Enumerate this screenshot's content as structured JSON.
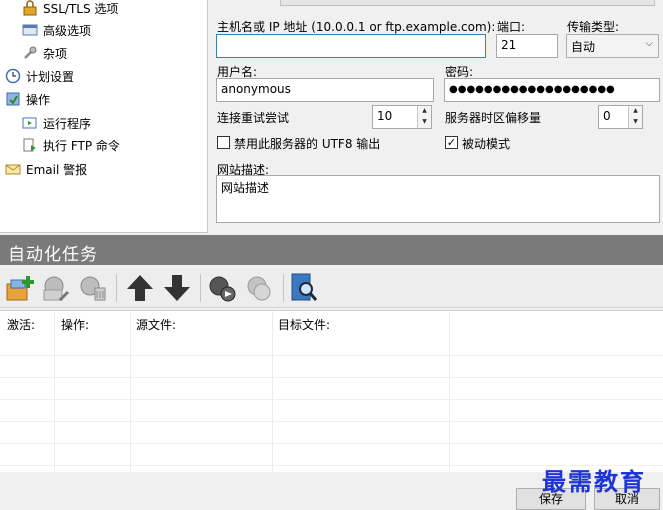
{
  "tree": {
    "items": [
      {
        "label": "SSL/TLS 选项",
        "icon": "lock-icon"
      },
      {
        "label": "高级选项",
        "icon": "settings-window-icon"
      },
      {
        "label": "杂项",
        "icon": "wrench-icon"
      },
      {
        "label": "计划设置",
        "icon": "clock-icon"
      },
      {
        "label": "操作",
        "icon": "actions-icon"
      },
      {
        "label": "运行程序",
        "icon": "run-program-icon"
      },
      {
        "label": "执行 FTP 命令",
        "icon": "ftp-command-icon"
      },
      {
        "label": "Email 警报",
        "icon": "email-icon"
      }
    ]
  },
  "form": {
    "host_label": "主机名或 IP 地址 (10.0.0.1 or ftp.example.com):",
    "host_value": "",
    "port_label": "端口:",
    "port_value": "21",
    "transfer_label": "传输类型:",
    "transfer_value": "自动",
    "user_label": "用户名:",
    "user_value": "anonymous",
    "password_label": "密码:",
    "password_value": "●●●●●●●●●●●●●●●●●●●",
    "retry_label": "连接重试尝试",
    "retry_value": "10",
    "tz_label": "服务器时区偏移量",
    "tz_value": "0",
    "utf8_label": "禁用此服务器的 UTF8 输出",
    "utf8_checked": false,
    "passive_label": "被动模式",
    "passive_checked": true,
    "desc_label": "网站描述:",
    "desc_value": "网站描述"
  },
  "automation": {
    "title": "自动化任务",
    "toolbar": [
      "add-task-icon",
      "edit-task-icon",
      "delete-task-icon",
      "move-up-icon",
      "move-down-icon",
      "run-task-icon",
      "clone-task-icon",
      "search-log-icon"
    ],
    "columns": [
      "激活:",
      "操作:",
      "源文件:",
      "目标文件:"
    ]
  },
  "buttons": {
    "save": "保存",
    "cancel": "取消"
  },
  "watermark": "最需教育",
  "colors": {
    "header_bg": "#7a7a7a",
    "accent_blue": "#3c7fb1",
    "watermark": "#1e35d6"
  }
}
